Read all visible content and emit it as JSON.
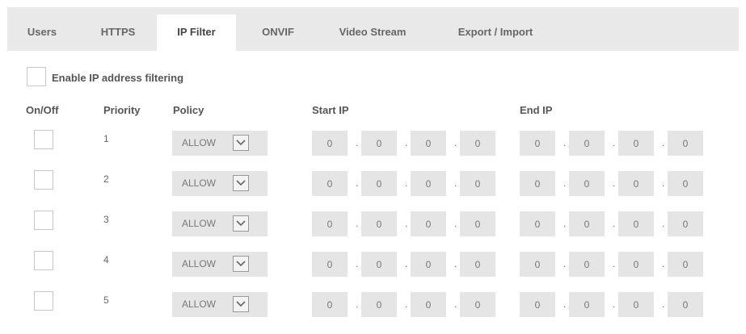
{
  "tabs": [
    {
      "label": "Users",
      "active": false
    },
    {
      "label": "HTTPS",
      "active": false
    },
    {
      "label": "IP Filter",
      "active": true
    },
    {
      "label": "ONVIF",
      "active": false
    },
    {
      "label": "Video Stream",
      "active": false
    },
    {
      "label": "Export / Import",
      "active": false
    }
  ],
  "enable_label": "Enable IP address filtering",
  "enable_checked": false,
  "headers": {
    "onoff": "On/Off",
    "priority": "Priority",
    "policy": "Policy",
    "start_ip": "Start IP",
    "end_ip": "End IP"
  },
  "octet_separator": ".",
  "rows": [
    {
      "priority": "1",
      "policy": "ALLOW",
      "start": [
        "0",
        "0",
        "0",
        "0"
      ],
      "end": [
        "0",
        "0",
        "0",
        "0"
      ]
    },
    {
      "priority": "2",
      "policy": "ALLOW",
      "start": [
        "0",
        "0",
        "0",
        "0"
      ],
      "end": [
        "0",
        "0",
        "0",
        "0"
      ]
    },
    {
      "priority": "3",
      "policy": "ALLOW",
      "start": [
        "0",
        "0",
        "0",
        "0"
      ],
      "end": [
        "0",
        "0",
        "0",
        "0"
      ]
    },
    {
      "priority": "4",
      "policy": "ALLOW",
      "start": [
        "0",
        "0",
        "0",
        "0"
      ],
      "end": [
        "0",
        "0",
        "0",
        "0"
      ]
    },
    {
      "priority": "5",
      "policy": "ALLOW",
      "start": [
        "0",
        "0",
        "0",
        "0"
      ],
      "end": [
        "0",
        "0",
        "0",
        "0"
      ]
    }
  ],
  "icons": {
    "dropdown": "chevron-down-icon"
  },
  "colors": {
    "frame": "#e9e9e9",
    "panel": "#ffffff",
    "field": "#e5e5e5",
    "text": "#555555"
  }
}
